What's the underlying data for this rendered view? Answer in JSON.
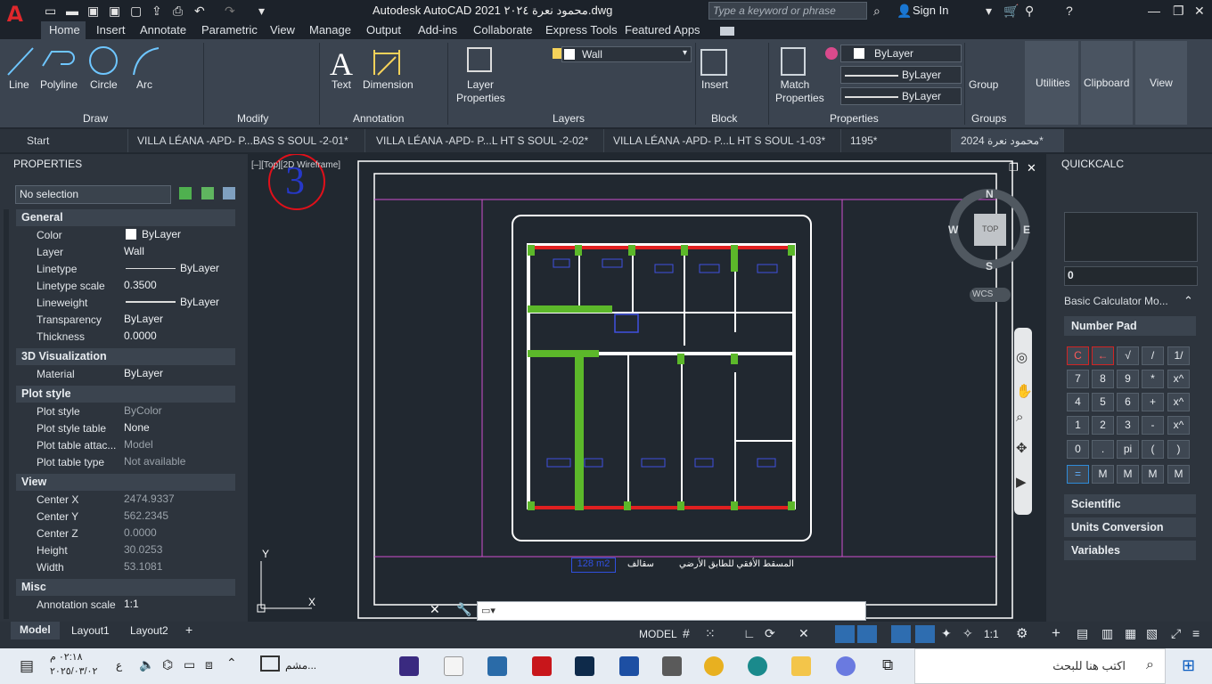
{
  "app": {
    "title": "Autodesk AutoCAD 2021  محمود نعرة ٢٠٢٤.dwg",
    "logo": "A",
    "search_placeholder": "Type a keyword or phrase",
    "signin": "Sign In"
  },
  "ribbon_tabs": [
    "Home",
    "Insert",
    "Annotate",
    "Parametric",
    "View",
    "Manage",
    "Output",
    "Add-ins",
    "Collaborate",
    "Express Tools",
    "Featured Apps"
  ],
  "ribbon": {
    "draw": {
      "line": "Line",
      "polyline": "Polyline",
      "circle": "Circle",
      "arc": "Arc",
      "panel": "Draw"
    },
    "modify": {
      "panel": "Modify"
    },
    "annotation": {
      "text": "Text",
      "dimension": "Dimension",
      "panel": "Annotation"
    },
    "layers": {
      "layer_properties": "Layer Properties",
      "current_layer": "Wall",
      "panel": "Layers"
    },
    "block": {
      "insert": "Insert",
      "panel": "Block"
    },
    "properties": {
      "match": "Match Properties",
      "color": "ByLayer",
      "linetype": "ByLayer",
      "lineweight": "ByLayer",
      "panel": "Properties"
    },
    "groups": {
      "group": "Group",
      "panel": "Groups"
    },
    "utilities": "Utilities",
    "clipboard": "Clipboard",
    "view": "View"
  },
  "doc_tabs": [
    "Start",
    "VILLA LÉANA -APD- P...BAS S SOUL -2-01*",
    "VILLA LÉANA -APD- P...L HT S SOUL -2-02*",
    "VILLA LÉANA -APD- P...L HT S SOUL -1-03*",
    "1195*",
    "محمود نعرة 2024*"
  ],
  "properties_panel": {
    "title": "PROPERTIES",
    "selection": "No selection",
    "sections": {
      "general": "General",
      "vis3d": "3D Visualization",
      "plot": "Plot style",
      "view": "View",
      "misc": "Misc"
    },
    "general": [
      [
        "Color",
        "ByLayer"
      ],
      [
        "Layer",
        "Wall"
      ],
      [
        "Linetype",
        "ByLayer"
      ],
      [
        "Linetype scale",
        "0.3500"
      ],
      [
        "Lineweight",
        "ByLayer"
      ],
      [
        "Transparency",
        "ByLayer"
      ],
      [
        "Thickness",
        "0.0000"
      ]
    ],
    "vis3d": [
      [
        "Material",
        "ByLayer"
      ]
    ],
    "plot": [
      [
        "Plot style",
        "ByColor"
      ],
      [
        "Plot style table",
        "None"
      ],
      [
        "Plot table attac...",
        "Model"
      ],
      [
        "Plot table type",
        "Not available"
      ]
    ],
    "view": [
      [
        "Center X",
        "2474.9337"
      ],
      [
        "Center Y",
        "562.2345"
      ],
      [
        "Center Z",
        "0.0000"
      ],
      [
        "Height",
        "30.0253"
      ],
      [
        "Width",
        "53.1081"
      ]
    ],
    "misc": [
      [
        "Annotation scale",
        "1:1"
      ]
    ]
  },
  "viewport": {
    "label": "[–][Top][2D Wireframe]",
    "badge": "3",
    "compass": {
      "n": "N",
      "s": "S",
      "e": "E",
      "w": "W",
      "top": "TOP",
      "wcs": "WCS"
    },
    "ucs_x": "X",
    "ucs_y": "Y",
    "drawing_area": "128 m2",
    "drawing_title": "المسقط الأفقي للطابق الأرضي",
    "drawing_scale": "سقالف"
  },
  "quickcalc": {
    "title": "QUICKCALC",
    "display": "0",
    "basic": "Basic  Calculator Mo...",
    "numpad": "Number Pad",
    "keys": [
      [
        "C",
        "←",
        "√",
        "/",
        "1/"
      ],
      [
        "7",
        "8",
        "9",
        "*",
        "x^"
      ],
      [
        "4",
        "5",
        "6",
        "+",
        "x^"
      ],
      [
        "1",
        "2",
        "3",
        "-",
        "x^"
      ],
      [
        "0",
        ".",
        "pi",
        "(",
        ")"
      ],
      [
        "=",
        "M",
        "M",
        "M",
        "M"
      ]
    ],
    "scientific": "Scientific",
    "units": "Units Conversion",
    "variables": "Variables"
  },
  "layout_tabs": [
    "Model",
    "Layout1",
    "Layout2"
  ],
  "status": {
    "model": "MODEL",
    "scale": "1:1"
  },
  "taskbar": {
    "time": "٠٢:١٨ م",
    "date": "٢٠٢٥/٠٣/٠٢",
    "lang": "ع",
    "search": "اكتب هنا للبحث",
    "app_label": "مشم..."
  }
}
